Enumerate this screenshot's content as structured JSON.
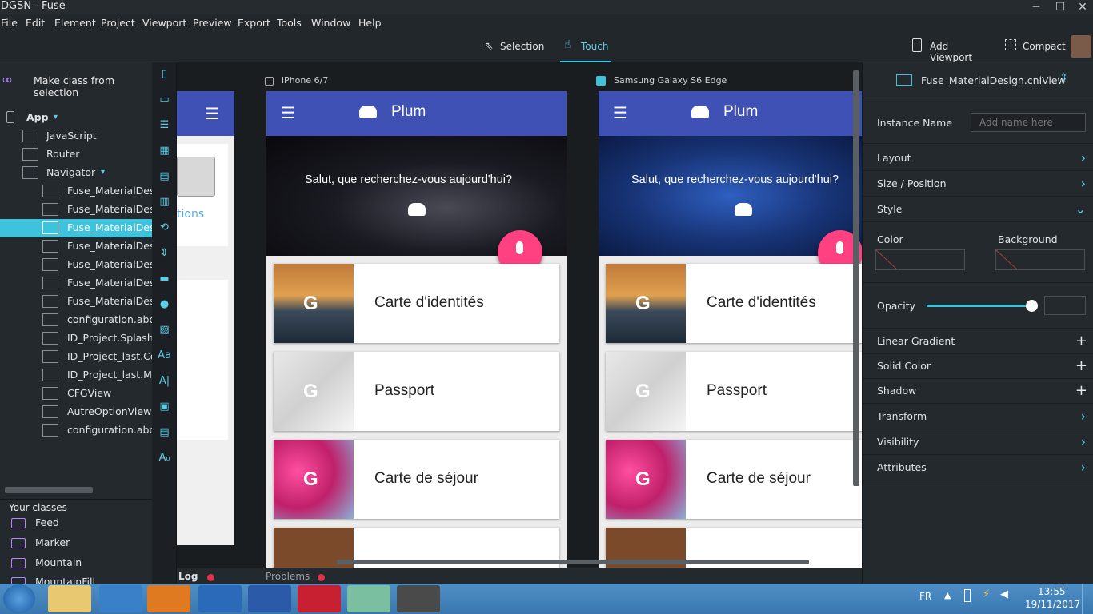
{
  "window": {
    "title": "DGSN - Fuse"
  },
  "menu": [
    "File",
    "Edit",
    "Element",
    "Project",
    "Viewport",
    "Preview",
    "Export",
    "Tools",
    "Window",
    "Help"
  ],
  "modes": {
    "selection": "Selection",
    "touch": "Touch",
    "add_viewport": "Add Viewport",
    "compact": "Compact"
  },
  "left": {
    "make_class": "Make class from selection",
    "tree": [
      "App",
      "JavaScript",
      "Router",
      "Navigator",
      "Fuse_MaterialDesig",
      "Fuse_MaterialDesig",
      "Fuse_MaterialDesig",
      "Fuse_MaterialDesig",
      "Fuse_MaterialDesig",
      "Fuse_MaterialDesig",
      "Fuse_MaterialDesig",
      "configuration.abou",
      "ID_Project.SplashV",
      "ID_Project_last.Cor",
      "ID_Project_last.Ma",
      "CFGView",
      "AutreOptionView",
      "configuration.abou"
    ],
    "your_classes": "Your classes",
    "classes": [
      "Feed",
      "Marker",
      "Mountain",
      "MountainFill"
    ]
  },
  "viewports": [
    {
      "label": "iPhone 6/7",
      "app_title": "Plum",
      "greeting": "Salut, que recherchez-vous aujourd'hui?",
      "cards": [
        "Carte d'identités",
        "Passport",
        "Carte de séjour"
      ]
    },
    {
      "label": "Samsung Galaxy S6 Edge",
      "app_title": "Plum",
      "greeting": "Salut, que recherchez-vous aujourd'hui?",
      "cards": [
        "Carte d'identités",
        "Passport",
        "Carte de séjour"
      ]
    }
  ],
  "partial_view": {
    "text": "tions"
  },
  "right": {
    "file": "Fuse_MaterialDesign.cniView",
    "instance_name": "Instance Name",
    "instance_placeholder": "Add name here",
    "layout": "Layout",
    "size_position": "Size / Position",
    "style": "Style",
    "color": "Color",
    "background": "Background",
    "opacity": "Opacity",
    "linear_gradient": "Linear Gradient",
    "solid_color": "Solid Color",
    "shadow": "Shadow",
    "transform": "Transform",
    "visibility": "Visibility",
    "attributes": "Attributes",
    "opacity_value": 1.0
  },
  "bottom": {
    "log": "Log",
    "problems": "Problems"
  },
  "taskbar": {
    "lang": "FR",
    "time": "13:55",
    "date": "19/11/2017"
  },
  "colors": {
    "accent": "#3fc3dd",
    "appbar": "#3f51b5",
    "fab": "#ff4081"
  }
}
